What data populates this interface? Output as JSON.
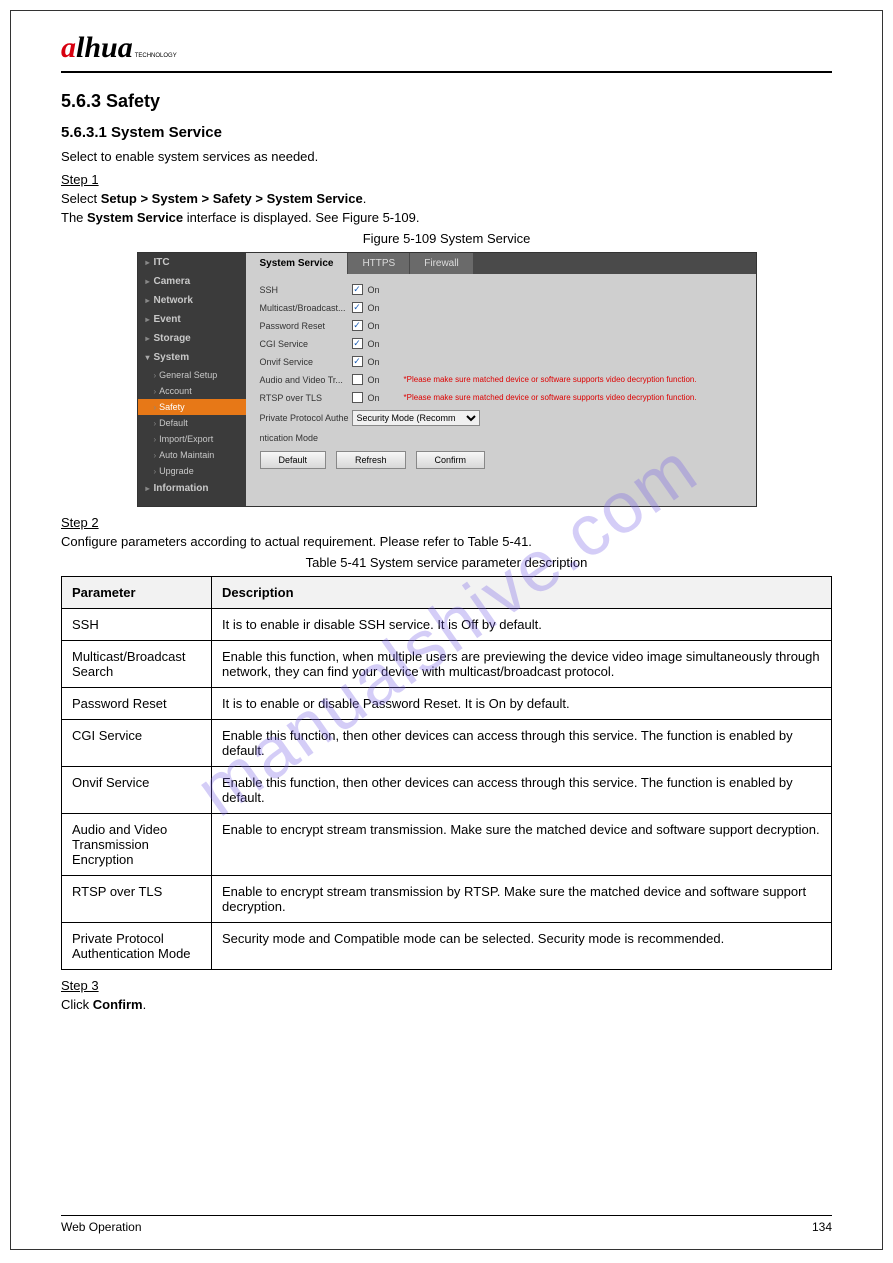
{
  "logo": {
    "a": "a",
    "hua": "lhua",
    "tech": "TECHNOLOGY"
  },
  "section_num_title": "5.6.3 Safety",
  "sub1_title": "5.6.3.1 System Service",
  "intro": "Select to enable system services as needed.",
  "step1": "Step 1",
  "step1_body_a": "Select ",
  "step1_body_b": "Setup > System > Safety > System Service",
  "step1_body_c": ".",
  "step1_body_d": "The ",
  "step1_body_e": "System Service",
  "step1_body_f": " interface is displayed. See Figure 5-109.",
  "fig_caption": "Figure 5-109 System Service",
  "screenshot": {
    "sidebar": {
      "items": [
        "ITC",
        "Camera",
        "Network",
        "Event",
        "Storage",
        "System",
        "Information"
      ],
      "system_children": [
        "General Setup",
        "Account",
        "Safety",
        "Default",
        "Import/Export",
        "Auto Maintain",
        "Upgrade"
      ],
      "active_child": "Safety"
    },
    "tabs": {
      "items": [
        "System Service",
        "HTTPS",
        "Firewall"
      ],
      "active": 0
    },
    "rows": [
      {
        "label": "SSH",
        "checked": true,
        "on": "On"
      },
      {
        "label": "Multicast/Broadcast...",
        "checked": true,
        "on": "On"
      },
      {
        "label": "Password Reset",
        "checked": true,
        "on": "On"
      },
      {
        "label": "CGI Service",
        "checked": true,
        "on": "On"
      },
      {
        "label": "Onvif Service",
        "checked": true,
        "on": "On"
      },
      {
        "label": "Audio and Video Tr...",
        "checked": false,
        "on": "On",
        "warn": "*Please make sure matched device or software supports video decryption function."
      },
      {
        "label": "RTSP over TLS",
        "checked": false,
        "on": "On",
        "warn": "*Please make sure matched device or software supports video decryption function."
      }
    ],
    "auth_label_a": "Private Protocol Authe",
    "auth_label_b": "ntication Mode",
    "auth_select": "Security Mode (Recomm",
    "buttons": {
      "default": "Default",
      "refresh": "Refresh",
      "confirm": "Confirm"
    }
  },
  "step2": "Step 2",
  "step2_body": "Configure parameters according to actual requirement. Please refer to Table 5-41.",
  "table_caption": "Table 5-41 System service parameter description",
  "table": {
    "headers": [
      "Parameter",
      "Description"
    ],
    "rows": [
      [
        "SSH",
        "It is to enable ir disable SSH service. It is Off by default."
      ],
      [
        "Multicast/Broadcast Search",
        "Enable this function, when multiple users are previewing the device video image simultaneously through network, they can find your device with multicast/broadcast protocol."
      ],
      [
        "Password Reset",
        "It is to enable or disable Password Reset. It is On by default."
      ],
      [
        "CGI Service",
        "Enable this function, then other devices can access through this service. The function is enabled by default."
      ],
      [
        "Onvif Service",
        "Enable this function, then other devices can access through this service. The function is enabled by default."
      ],
      [
        "Audio and Video Transmission Encryption",
        "Enable to encrypt stream transmission. Make sure the matched device and software support decryption."
      ],
      [
        "RTSP over TLS",
        "Enable to encrypt stream transmission by RTSP. Make sure the matched device and software support decryption."
      ],
      [
        "Private Protocol Authentication Mode",
        "Security mode and Compatible mode can be selected. Security mode is recommended."
      ]
    ]
  },
  "step3": "Step 3",
  "step3_body_a": "Click ",
  "step3_body_b": "Confirm",
  "step3_body_c": ".",
  "watermark": "manualshive.com",
  "footer": {
    "left": "Web Operation",
    "right": "134"
  }
}
